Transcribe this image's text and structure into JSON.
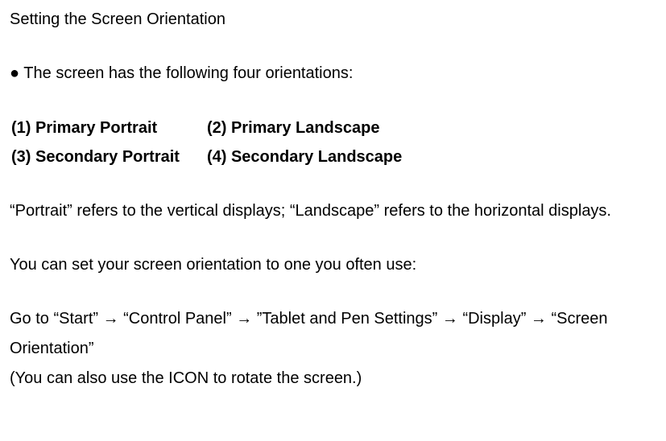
{
  "title": "Setting the Screen Orientation",
  "bulletChar": "●",
  "bulletText": "The screen has the following four orientations:",
  "orientations": {
    "r1c1": "(1) Primary Portrait",
    "r1c2": "(2) Primary Landscape",
    "r2c1": "(3) Secondary Portrait",
    "r2c2": "(4) Secondary Landscape"
  },
  "defPortraitLandscape": "“Portrait” refers to the vertical displays; “Landscape” refers to the horizontal displays.",
  "setOrientationText": "You can set your screen orientation to one you often use:",
  "nav": {
    "prefix": "Go to ",
    "steps": [
      "“Start”",
      "“Control Panel”",
      "”Tablet and Pen Settings”",
      "“Display”",
      "“Screen Orientation”"
    ],
    "arrow": "→"
  },
  "iconNote": "(You can also use the ICON to rotate the screen.)"
}
